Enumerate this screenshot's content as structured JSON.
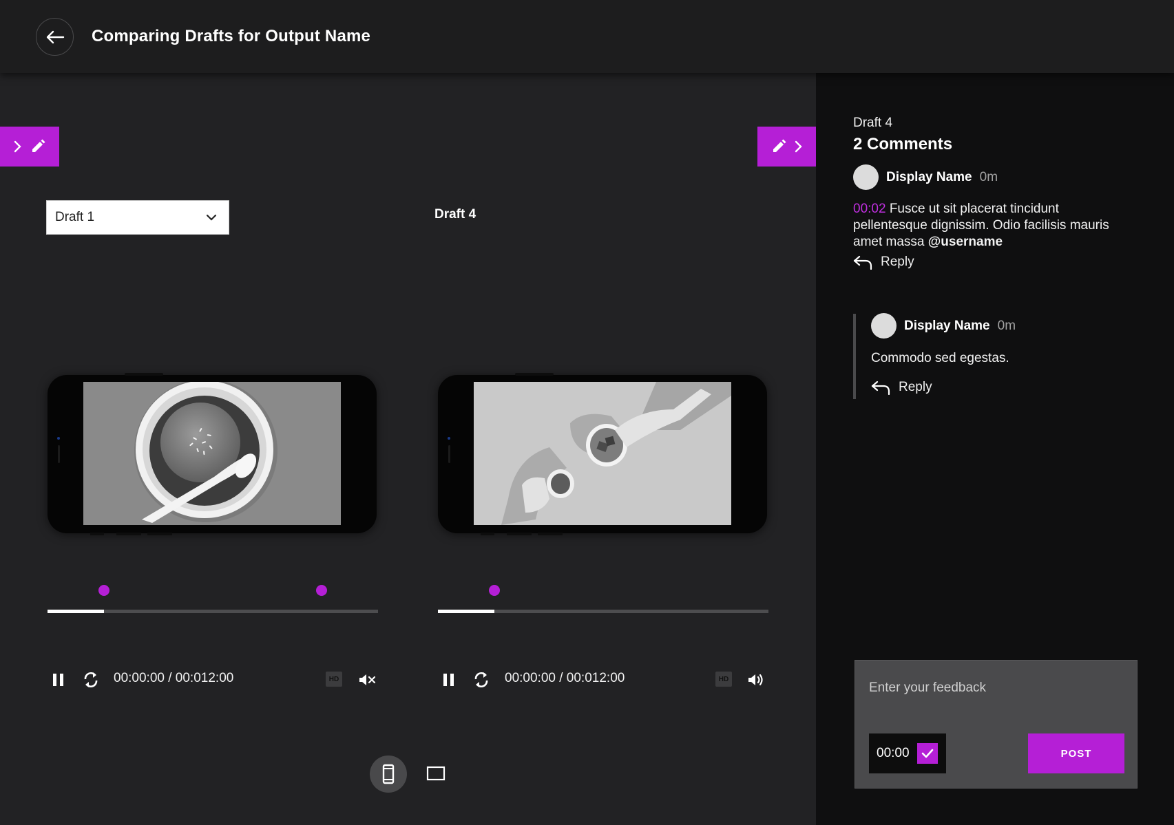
{
  "header": {
    "title": "Comparing Drafts for Output Name",
    "back_icon": "arrow-left-icon"
  },
  "colors": {
    "accent": "#b51fd6",
    "background": "#222224",
    "header_bg": "#1d1d1e",
    "panel_bg": "#0f0f10"
  },
  "compare": {
    "left": {
      "selected_draft": "Draft 1",
      "timecode": "00:00:00 / 00:012:00",
      "hd_label": "HD",
      "progress": 0.17,
      "comment_markers": [
        0.17,
        0.83
      ],
      "volume_state": "muted",
      "icons": [
        "pause-icon",
        "replay-icon",
        "hd-icon",
        "volume-muted-icon"
      ]
    },
    "right": {
      "draft_label": "Draft 4",
      "timecode": "00:00:00 / 00:012:00",
      "hd_label": "HD",
      "progress": 0.17,
      "comment_markers": [
        0.17
      ],
      "volume_state": "on",
      "icons": [
        "pause-icon",
        "replay-icon",
        "hd-icon",
        "volume-on-icon"
      ]
    }
  },
  "view_modes": {
    "active": "mobile",
    "icons": [
      "mobile-view-icon",
      "desktop-view-icon"
    ]
  },
  "comments_panel": {
    "draft": "Draft 4",
    "count_label": "2 Comments",
    "comments": [
      {
        "name": "Display Name",
        "time": "0m",
        "timestamp": "00:02",
        "text": " Fusce ut sit placerat tincidunt pellentesque dignissim. Odio facilisis mauris amet massa ",
        "mention": "@username",
        "reply_label": "Reply"
      },
      {
        "name": "Display Name",
        "time": "0m",
        "text": "Commodo sed egestas.",
        "reply_label": "Reply"
      }
    ],
    "feedback": {
      "placeholder": "Enter your feedback",
      "time_value": "00:00",
      "post_label": "POST"
    }
  }
}
